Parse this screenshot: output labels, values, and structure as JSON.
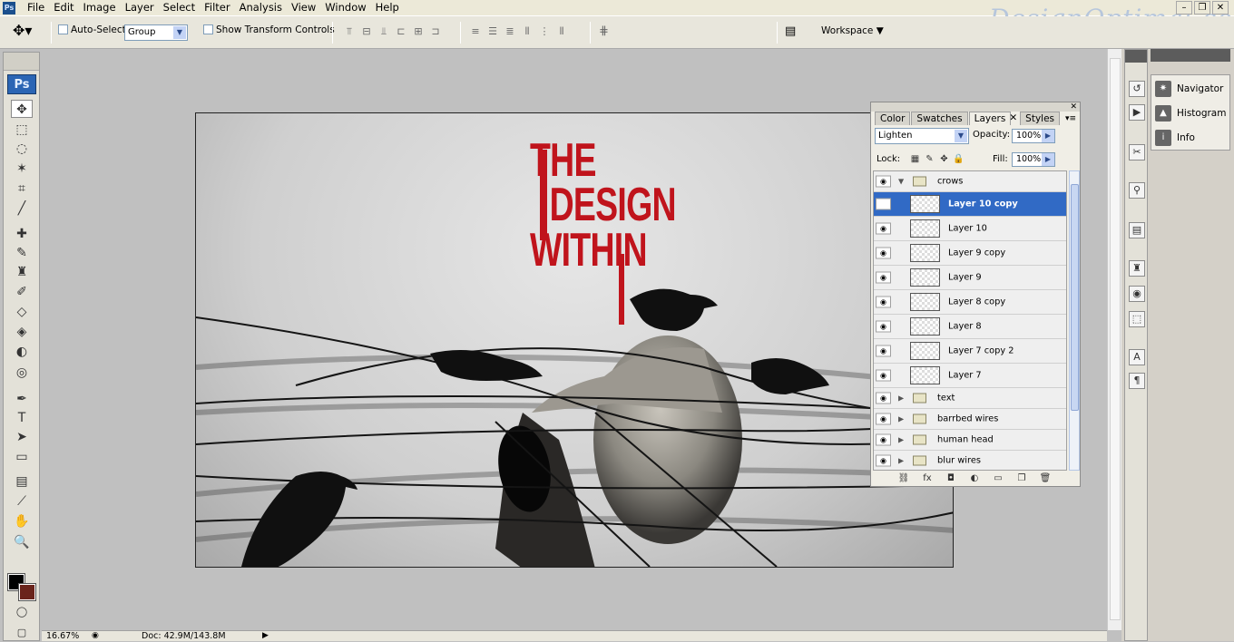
{
  "app": {
    "menu": [
      "File",
      "Edit",
      "Image",
      "Layer",
      "Select",
      "Filter",
      "Analysis",
      "View",
      "Window",
      "Help"
    ],
    "watermark": "DesignOptimal.com"
  },
  "options_bar": {
    "auto_select_label": "Auto-Select:",
    "auto_select_value": "Group",
    "show_transform_label": "Show Transform Controls",
    "workspace_label": "Workspace"
  },
  "toolbox": {
    "badge": "Ps",
    "tools": [
      {
        "name": "move-tool",
        "glyph": "✥",
        "selected": true
      },
      {
        "name": "marquee-tool",
        "glyph": "⬚"
      },
      {
        "name": "lasso-tool",
        "glyph": "◌"
      },
      {
        "name": "magic-wand-tool",
        "glyph": "✶"
      },
      {
        "name": "crop-tool",
        "glyph": "⌗"
      },
      {
        "name": "eyedropper-tool",
        "glyph": "╱"
      },
      {
        "name": "healing-brush-tool",
        "glyph": "✚"
      },
      {
        "name": "brush-tool",
        "glyph": "✎"
      },
      {
        "name": "clone-stamp-tool",
        "glyph": "♜"
      },
      {
        "name": "history-brush-tool",
        "glyph": "✐"
      },
      {
        "name": "eraser-tool",
        "glyph": "◇"
      },
      {
        "name": "paint-bucket-tool",
        "glyph": "◈"
      },
      {
        "name": "dodge-tool",
        "glyph": "◐"
      },
      {
        "name": "sponge-tool",
        "glyph": "◎"
      },
      {
        "name": "pen-tool",
        "glyph": "✒"
      },
      {
        "name": "type-tool",
        "glyph": "T"
      },
      {
        "name": "path-selection-tool",
        "glyph": "➤"
      },
      {
        "name": "shape-tool",
        "glyph": "▭"
      },
      {
        "name": "notes-tool",
        "glyph": "▤"
      },
      {
        "name": "eyedropper-2-tool",
        "glyph": "⟋"
      },
      {
        "name": "hand-tool",
        "glyph": "✋"
      },
      {
        "name": "zoom-tool",
        "glyph": "🔍"
      }
    ],
    "foreground_color": "#000000",
    "background_color": "#6a241b"
  },
  "document": {
    "title_lines": [
      "THE",
      "DESIGN",
      "WITHIN"
    ],
    "title_color": "#c0141c"
  },
  "status": {
    "zoom": "16.67%",
    "doc_info": "Doc: 42.9M/143.8M"
  },
  "dock": {
    "items": [
      {
        "label": "Navigator",
        "icon": "navigator-icon"
      },
      {
        "label": "Histogram",
        "icon": "histogram-icon"
      },
      {
        "label": "Info",
        "icon": "info-icon"
      }
    ]
  },
  "layers_panel": {
    "tabs": [
      "Color",
      "Swatches",
      "Layers",
      "Styles"
    ],
    "active_tab": "Layers",
    "blend_mode": "Lighten",
    "opacity_label": "Opacity:",
    "opacity": "100%",
    "lock_label": "Lock:",
    "fill_label": "Fill:",
    "fill": "100%",
    "layers": [
      {
        "name": "crows",
        "type": "group",
        "expanded": true
      },
      {
        "name": "Layer 10 copy",
        "type": "layer",
        "selected": true
      },
      {
        "name": "Layer 10",
        "type": "layer"
      },
      {
        "name": "Layer 9 copy",
        "type": "layer"
      },
      {
        "name": "Layer 9",
        "type": "layer"
      },
      {
        "name": "Layer 8 copy",
        "type": "layer"
      },
      {
        "name": "Layer 8",
        "type": "layer"
      },
      {
        "name": "Layer 7 copy 2",
        "type": "layer"
      },
      {
        "name": "Layer 7",
        "type": "layer"
      },
      {
        "name": "text",
        "type": "group"
      },
      {
        "name": "barrbed wires",
        "type": "group"
      },
      {
        "name": "human head",
        "type": "group"
      },
      {
        "name": "blur wires",
        "type": "group"
      }
    ]
  }
}
